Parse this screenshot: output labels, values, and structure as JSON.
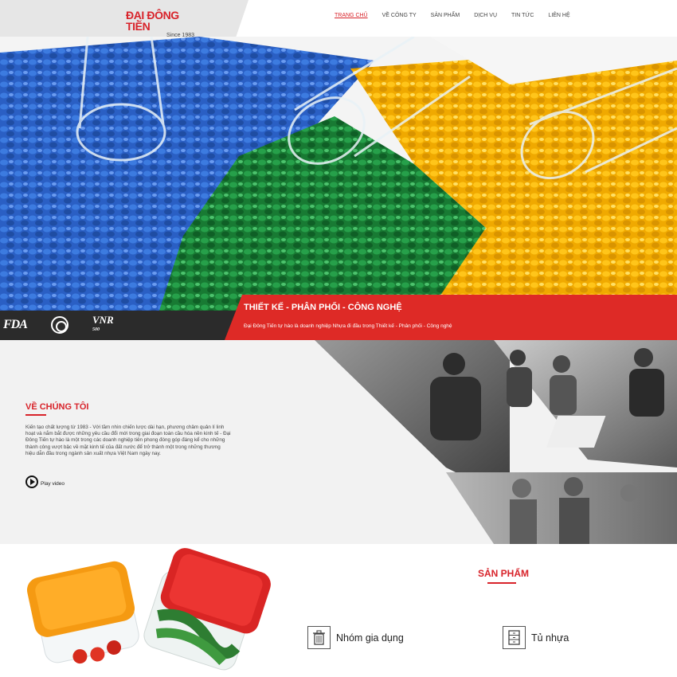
{
  "brand": {
    "name": "ĐẠI ĐÔNG TIẾN",
    "since": "Since 1983"
  },
  "nav": {
    "items": [
      {
        "label": "Trang chủ",
        "active": true
      },
      {
        "label": "Về công ty",
        "active": false
      },
      {
        "label": "Sản phẩm",
        "active": false
      },
      {
        "label": "Dịch vụ",
        "active": false
      },
      {
        "label": "Tin tức",
        "active": false
      },
      {
        "label": "Liên hệ",
        "active": false
      }
    ]
  },
  "certs": {
    "fda": "FDA",
    "vnr": "VNR",
    "vnr_sub": "500"
  },
  "banner": {
    "title": "THIẾT KẾ - PHÂN PHỐI - CÔNG NGHỆ",
    "subtitle": "Đại Đông Tiến tự hào là doanh nghiệp Nhựa đi đầu trong Thiết kế - Phân phối - Công nghệ"
  },
  "about": {
    "title": "VỀ CHÚNG TÔI",
    "text": "Kiến tạo chất lượng từ 1983 - Với tầm nhìn chiến lược dài hạn, phương châm quản lí linh hoạt và nắm bắt được những yêu cầu đổi mới trong giai đoạn toàn cầu hóa nền kinh tế - Đại Đông Tiến tự hào là một trong các doanh nghiệp tiên phong đóng góp đáng kể cho những thành công vượt bậc về mặt kinh tế của đất nước để trở thành một trong những thương hiệu dẫn đầu trong ngành sản xuất nhựa Việt Nam ngày nay.",
    "play_label": "Play video"
  },
  "products": {
    "title": "SẢN PHẨM",
    "categories": [
      {
        "label": "Nhóm gia dụng",
        "icon": "trash-bin-icon"
      },
      {
        "label": "Tủ nhựa",
        "icon": "drawer-cabinet-icon"
      }
    ]
  },
  "colors": {
    "accent": "#de2a26",
    "dark": "#2b2b2b",
    "blue": "#2f64c9",
    "green": "#1f8a3c",
    "yellow": "#f5b800"
  }
}
